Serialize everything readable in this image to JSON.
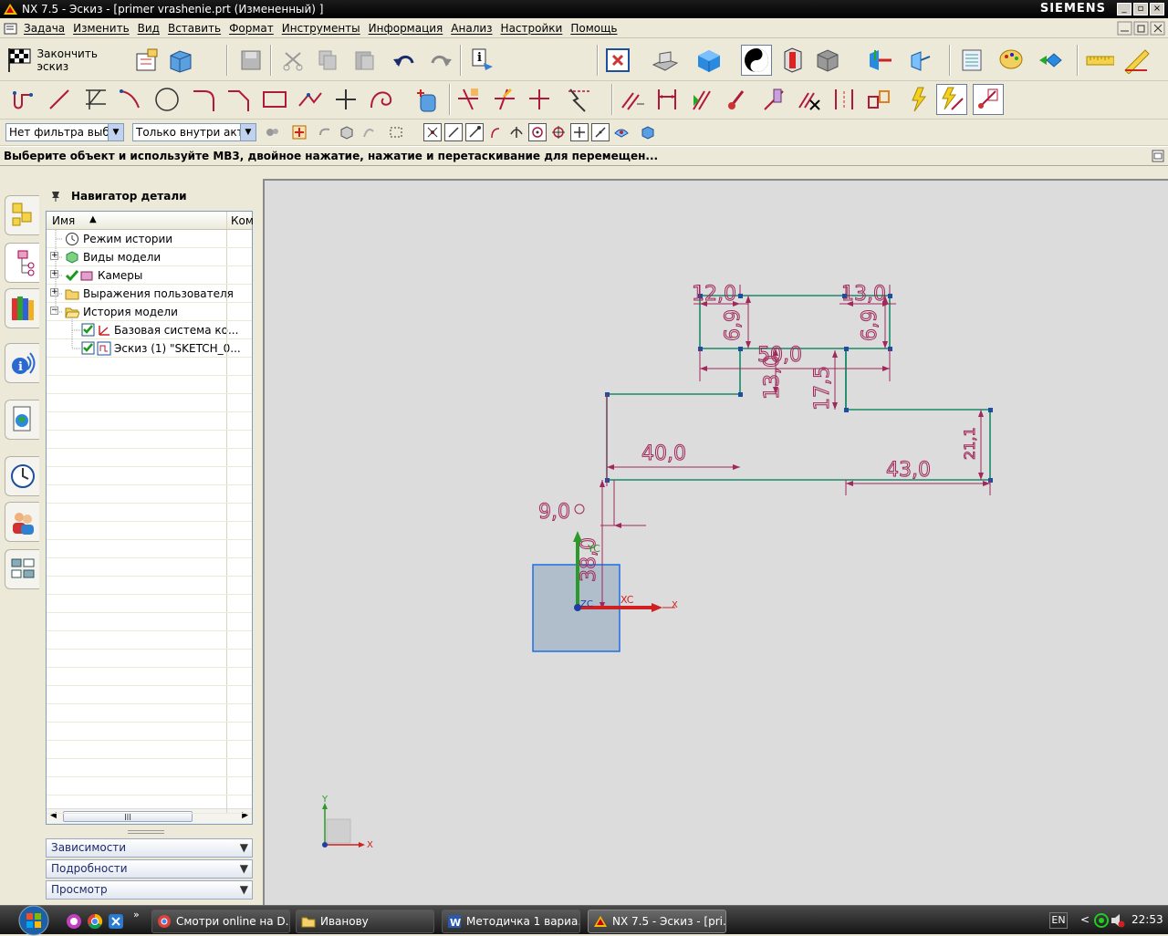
{
  "window": {
    "title": "NX 7.5 - Эскиз - [primer vrashenie.prt (Измененный) ]",
    "brand": "SIEMENS",
    "controls": [
      "_",
      "▫",
      "×"
    ]
  },
  "menu": [
    "Задача",
    "Изменить",
    "Вид",
    "Вставить",
    "Формат",
    "Инструменты",
    "Информация",
    "Анализ",
    "Настройки",
    "Помощь"
  ],
  "toolbar1": {
    "finish_sketch_label": "Закончить эскиз"
  },
  "selection_bar": {
    "type_filter": "Нет фильтра выбор",
    "scope": "Только внутри актие"
  },
  "prompt": "Выберите объект и используйте MB3, двойное нажатие, нажатие и перетаскивание для перемещен...",
  "navigator": {
    "title": "Навигатор детали",
    "columns": [
      "Имя",
      "Ком"
    ],
    "nodes": [
      {
        "label": "Режим истории"
      },
      {
        "label": "Виды модели"
      },
      {
        "label": "Камеры"
      },
      {
        "label": "Выражения пользователя"
      },
      {
        "label": "История модели"
      },
      {
        "label": "Базовая система ко..."
      },
      {
        "label": "Эскиз (1) \"SKETCH_0..."
      }
    ],
    "panels": [
      "Зависимости",
      "Подробности",
      "Просмотр"
    ]
  },
  "sketch": {
    "dimensions": [
      "12,0",
      "13,0",
      "6,9",
      "6,9",
      "50,0",
      "13,0",
      "17,5",
      "40,0",
      "43,0",
      "21,1",
      "9,0",
      "38,0"
    ],
    "axes": {
      "xc": "XC",
      "yc": "YC",
      "zc": "ZC",
      "x": "X",
      "y": "Y"
    }
  },
  "taskbar": {
    "tasks": [
      {
        "label": "Смотри online на D..."
      },
      {
        "label": "Иванову"
      },
      {
        "label": "Методичка 1 вариа..."
      },
      {
        "label": "NX 7.5 - Эскиз - [pri..."
      }
    ],
    "lang": "EN",
    "clock": "22:53"
  }
}
